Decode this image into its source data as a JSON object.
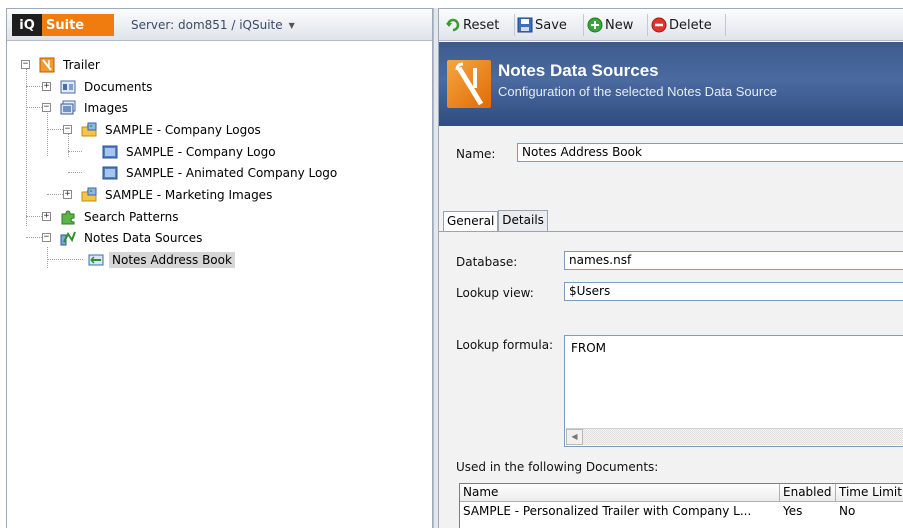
{
  "app": {
    "logo_iq": "iQ",
    "logo_suite": "Suite",
    "server_label": "Server: dom851 / iQSuite"
  },
  "tree": {
    "root": "Trailer",
    "documents": "Documents",
    "images": "Images",
    "company_logos": "SAMPLE - Company Logos",
    "company_logo": "SAMPLE - Company Logo",
    "animated_logo": "SAMPLE - Animated Company Logo",
    "marketing_images": "SAMPLE - Marketing Images",
    "search_patterns": "Search Patterns",
    "notes_data_sources": "Notes Data Sources",
    "notes_address_book": "Notes Address Book"
  },
  "toolbar": {
    "reset": "Reset",
    "save": "Save",
    "new": "New",
    "delete": "Delete"
  },
  "banner": {
    "title": "Notes Data Sources",
    "subtitle": "Configuration of the selected Notes Data Source"
  },
  "form": {
    "name_label": "Name:",
    "name_value": "Notes Address Book",
    "tabs": [
      "General",
      "Details"
    ],
    "database_label": "Database:",
    "database_value": "names.nsf",
    "lookup_view_label": "Lookup view:",
    "lookup_view_value": "$Users",
    "lookup_formula_label": "Lookup formula:",
    "lookup_formula_value": "FROM",
    "used_in_label": "Used in the following Documents:"
  },
  "documents_table": {
    "columns": [
      "Name",
      "Enabled",
      "Time Limit"
    ],
    "rows": [
      [
        "SAMPLE - Personalized Trailer with Company L...",
        "Yes",
        "No"
      ]
    ]
  },
  "colors": {
    "banner_blue": "#3d5b8d",
    "logo_orange": "#f07c10",
    "selection_gray": "#d6d6d6"
  }
}
